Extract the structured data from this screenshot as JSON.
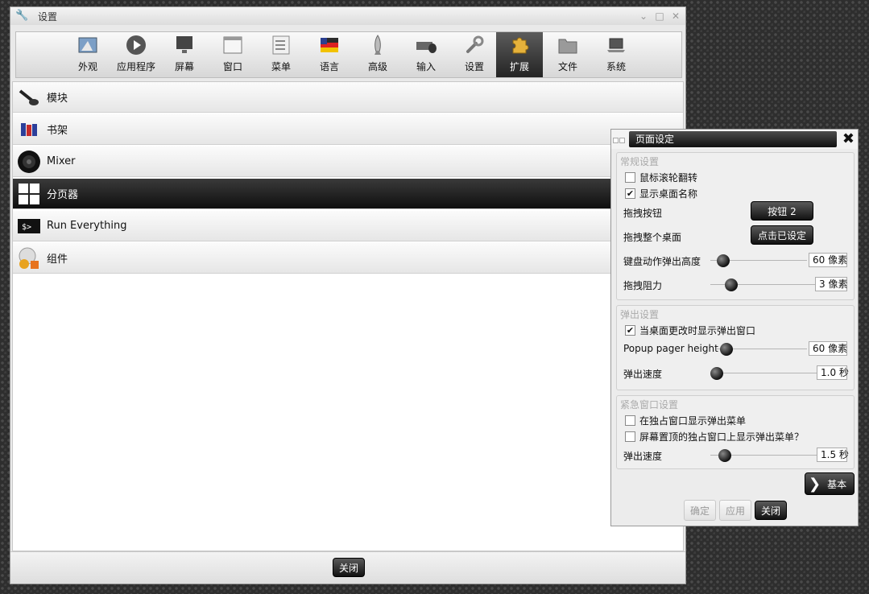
{
  "window": {
    "title": "设置",
    "close_label": "关闭"
  },
  "toolbar": {
    "items": [
      {
        "label": "外观"
      },
      {
        "label": "应用程序"
      },
      {
        "label": "屏幕"
      },
      {
        "label": "窗口"
      },
      {
        "label": "菜单"
      },
      {
        "label": "语言"
      },
      {
        "label": "高级"
      },
      {
        "label": "输入"
      },
      {
        "label": "设置"
      },
      {
        "label": "扩展",
        "active": true
      },
      {
        "label": "文件"
      },
      {
        "label": "系统"
      }
    ]
  },
  "plugins": {
    "items": [
      {
        "label": "模块"
      },
      {
        "label": "书架"
      },
      {
        "label": "Mixer"
      },
      {
        "label": "分页器",
        "selected": true
      },
      {
        "label": "Run Everything"
      },
      {
        "label": "组件"
      }
    ],
    "run_icon_text": "$>"
  },
  "dialog": {
    "title": "页面设定",
    "general": {
      "title": "常规设置",
      "wheel_flip": {
        "label": "鼠标滚轮翻转",
        "checked": false
      },
      "show_desk_name": {
        "label": "显示桌面名称",
        "checked": true
      },
      "drag_button_label": "拖拽按钮",
      "drag_button_value": "按钮 2",
      "drag_desktop_label": "拖拽整个桌面",
      "drag_desktop_value": "点击已设定",
      "keyboard_popup_label": "键盘动作弹出高度",
      "keyboard_popup_value": "60 像素",
      "keyboard_popup_level": 0.1,
      "drag_resist_label": "拖拽阻力",
      "drag_resist_value": "3 像素",
      "drag_resist_level": 0.08
    },
    "popup": {
      "title": "弹出设置",
      "show_popup": {
        "label": "当桌面更改时显示弹出窗口",
        "checked": true
      },
      "pager_height_label": "Popup pager height",
      "pager_height_value": "60 像素",
      "pager_height_level": 0.1,
      "speed_label": "弹出速度",
      "speed_value": "1.0 秒",
      "speed_level": 0.05
    },
    "urgent": {
      "title": "紧急窗口设置",
      "show_urgent": {
        "label": "在独占窗口显示弹出菜单",
        "checked": false
      },
      "show_top_urgent": {
        "label": "屏幕置顶的独占窗口上显示弹出菜单？",
        "checked": false
      },
      "speed_label": "弹出速度",
      "speed_value": "1.5 秒",
      "speed_level": 0.1
    },
    "basic_label": "基本",
    "ok_label": "确定",
    "apply_label": "应用",
    "close_label": "关闭"
  }
}
